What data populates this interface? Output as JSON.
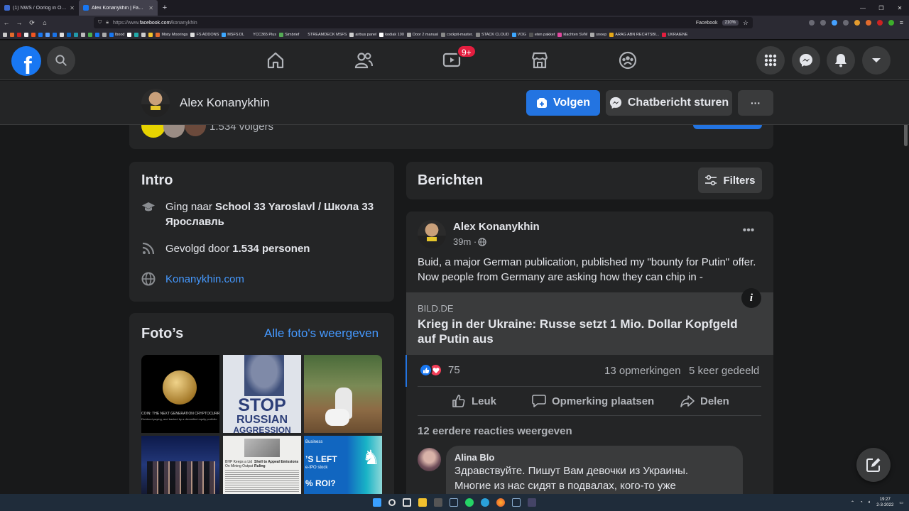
{
  "browser": {
    "tabs": [
      {
        "title": "(1) NWS / Oorlog in Oekraïne #",
        "active": false
      },
      {
        "title": "Alex Konanykhin | Facebook",
        "active": true
      }
    ],
    "url_scheme": "https://www.",
    "url_domain": "facebook.com",
    "url_path": "/konanykhin",
    "site_label": "Facebook",
    "zoom": "210%",
    "bookmarks": [
      "Misty Moorings",
      "FS ADDONS",
      "MSFS DL",
      "YCC365 Plus",
      "Simbrief",
      "STREAMDECK MSFS",
      "airbus panel",
      "kodiak 100",
      "Door 2 manual",
      "cockpit-master.",
      "STACK CLOUD",
      "VOG",
      "eten pakket",
      "klachten SVM",
      "snoep",
      "ARAG ABN RECHTSBI...",
      "UKRAIENE"
    ],
    "bookmark_short": "lbood"
  },
  "fb": {
    "notification_count": "9+",
    "accent": "#1877f2"
  },
  "profile": {
    "name": "Alex Konanykhin",
    "follow_label": "Volgen",
    "message_label": "Chatbericht sturen",
    "more_label": "···",
    "followers_text": "1.534 volgers"
  },
  "intro": {
    "title": "Intro",
    "school_prefix": "Ging naar ",
    "school": "School 33 Yaroslavl / Школа 33 Ярославль",
    "followed_prefix": "Gevolgd door ",
    "followed_count": "1.534 personen",
    "website": "Konanykhin.com"
  },
  "photos": {
    "title": "Foto’s",
    "all_link": "Alle foto's weergeven",
    "coin_caption_1": "COIN: THE NEXT GENERATION CRYPTOCURRE",
    "coin_caption_2": "Dividend-paying, and backed by a diversified equity portfolio",
    "stop_1": "STOP",
    "stop_2": "RUSSIAN",
    "stop_3": "AGGRESSION",
    "news_1": "BHP Keeps a Lid",
    "news_2": "On Mining Output",
    "news_3": "Shell to Appeal Emissions Ruling",
    "ad_1": "Business",
    "ad_2": "’S LEFT",
    "ad_3": "e-IPO stock",
    "ad_4": "% ROI?"
  },
  "posts": {
    "title": "Berichten",
    "filters_label": "Filters",
    "post": {
      "author": "Alex Konanykhin",
      "time": "39m · ",
      "text": "Buid, a major German publication, published my \"bounty for Putin\" offer.  Now people from Germany are asking how they can chip in -",
      "link_source": "BILD.DE",
      "link_title": "Krieg in der Ukraine: Russe setzt 1 Mio. Dollar Kopfgeld auf Putin aus",
      "reactions": "75",
      "comments": "13 opmerkingen",
      "shares": "5 keer gedeeld",
      "like_label": "Leuk",
      "comment_label": "Opmerking plaatsen",
      "share_label": "Delen",
      "earlier_comments": "12 eerdere reacties weergeven",
      "comment": {
        "author": "Alina Blo",
        "text_1": "Здравствуйте. Пишут Вам девочки из Украины.",
        "text_2": "Многие из нас сидят в подвалах, кого-то уже"
      }
    }
  },
  "taskbar": {
    "time": "19:27",
    "date": "2-3-2022"
  }
}
